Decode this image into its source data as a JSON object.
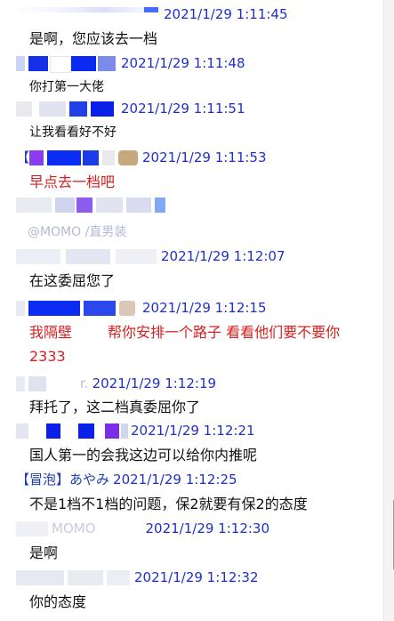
{
  "entries": [
    {
      "time": "2021/1/29 1:11:45",
      "message": "是啊，您应该去一档",
      "message_color": "default"
    },
    {
      "time": "2021/1/29 1:11:48",
      "message": "你打第一大佬",
      "message_color": "default"
    },
    {
      "time": "2021/1/29 1:11:51",
      "message": "让我看看好不好",
      "message_color": "default"
    },
    {
      "tag_open": "【",
      "time": "2021/1/29 1:11:53",
      "message": "早点去一档吧",
      "message_color": "red"
    },
    {
      "message_fragment": "@MOMO /直男装",
      "message_color": "default"
    },
    {
      "time": "2021/1/29 1:12:07",
      "message": "在这委屈您了",
      "message_color": "default"
    },
    {
      "time": "2021/1/29 1:12:15",
      "message_part1": "我隔壁",
      "message_part2": "帮你安排一个路子 看看他们要不要你",
      "message_line2": "2333",
      "message_color": "red"
    },
    {
      "sender_fragment": "r.",
      "time": "2021/1/29 1:12:19",
      "message": "拜托了，这二档真委屈你了",
      "message_color": "default"
    },
    {
      "time": "2021/1/29 1:12:21",
      "message": "国人第一的会我这边可以给你内推呢",
      "message_color": "default"
    },
    {
      "sender_tag": "【冒泡】",
      "sender_name": "あやみ",
      "time": "2021/1/29 1:12:25",
      "message": "不是1档不1档的问题，保2就要有保2的态度",
      "message_color": "default"
    },
    {
      "sender_fragment": "MOMO",
      "time": "2021/1/29 1:12:30",
      "message": "是啊",
      "message_color": "default"
    },
    {
      "time": "2021/1/29 1:12:32",
      "message": "你的态度",
      "message_color": "default"
    }
  ],
  "colors": {
    "timestamp": "#1f30c8",
    "message_text": "#111111",
    "highlight_red": "#d42020",
    "redaction_blue": "#0a1fe8",
    "redaction_purple": "#7b35e6"
  }
}
